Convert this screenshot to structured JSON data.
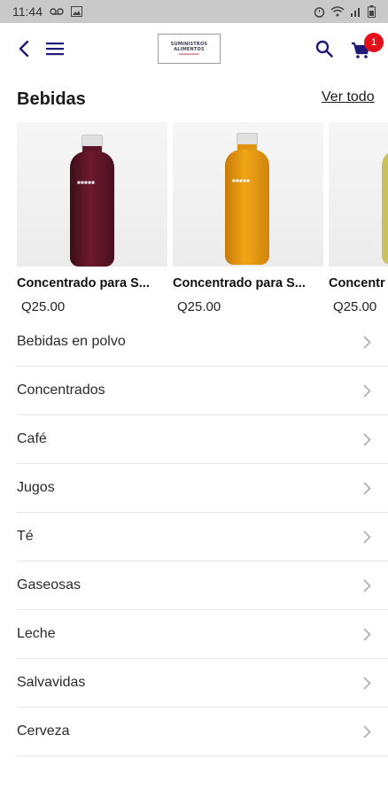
{
  "status_bar": {
    "time": "11:44"
  },
  "header": {
    "logo_lines": [
      "SUMINISTROS",
      "ALIMENTOS"
    ],
    "cart_count": "1",
    "accent": "#1f1a7a",
    "badge_color": "#e4111a"
  },
  "section": {
    "title": "Bebidas",
    "see_all": "Ver todo"
  },
  "products": [
    {
      "name": "Concentrado para S...",
      "price": "Q25.00",
      "bottle_color": "#5e1426"
    },
    {
      "name": "Concentrado para S...",
      "price": "Q25.00",
      "bottle_color": "#e0920f"
    },
    {
      "name": "Concentr",
      "price": "Q25.00",
      "bottle_color": "#d9d26a"
    }
  ],
  "categories": [
    {
      "label": "Bebidas en polvo"
    },
    {
      "label": "Concentrados"
    },
    {
      "label": "Café"
    },
    {
      "label": "Jugos"
    },
    {
      "label": "Té"
    },
    {
      "label": "Gaseosas"
    },
    {
      "label": "Leche"
    },
    {
      "label": "Salvavidas"
    },
    {
      "label": "Cerveza"
    }
  ],
  "icons": {
    "back": "back-arrow-icon",
    "menu": "hamburger-menu-icon",
    "search": "search-icon",
    "cart": "cart-icon",
    "chevron": "chevron-right-icon"
  }
}
